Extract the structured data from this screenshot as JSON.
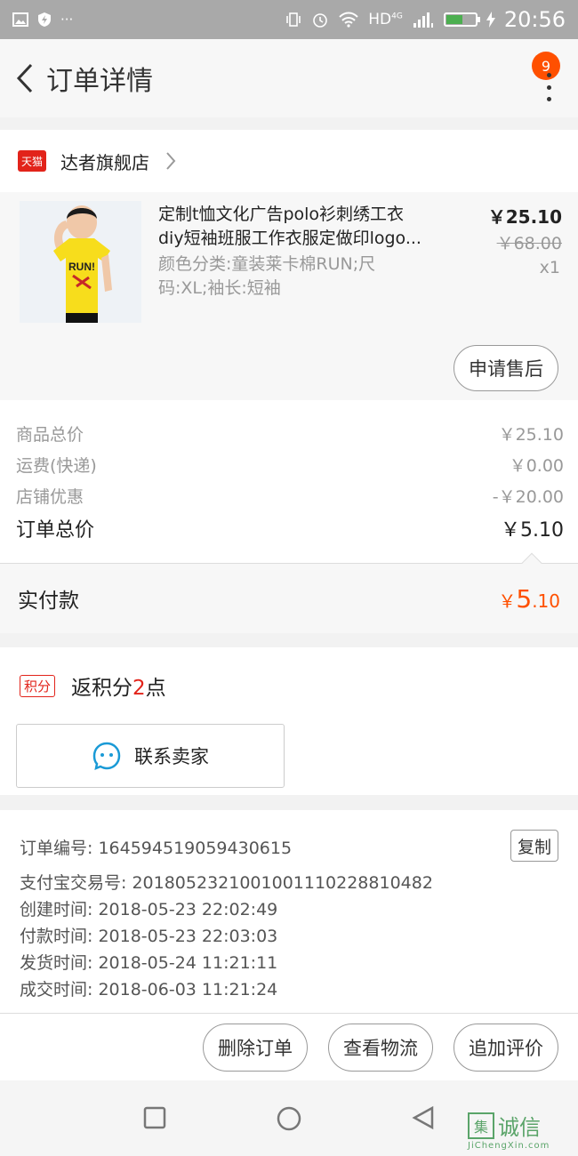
{
  "status_bar": {
    "time": "20:56",
    "network": "HD",
    "network_sub": "4G"
  },
  "header": {
    "title": "订单详情",
    "badge_count": "9"
  },
  "shop": {
    "platform_icon_label": "天猫",
    "name": "达者旗舰店"
  },
  "product": {
    "title_line1": "定制t恤文化广告polo衫刺绣工衣",
    "title_line2": "diy短袖班服工作衣服定做印logo...",
    "sku_line1": "颜色分类:童装莱卡棉RUN;尺",
    "sku_line2": "码:XL;袖长:短袖",
    "price": "￥25.10",
    "original_price": "￥68.00",
    "quantity": "x1",
    "image_text": "RUN!",
    "aftersale_label": "申请售后"
  },
  "summary": {
    "rows": [
      {
        "label": "商品总价",
        "value": "￥25.10"
      },
      {
        "label": "运费(快递)",
        "value": "￥0.00"
      },
      {
        "label": "店铺优惠",
        "value": "-￥20.00"
      }
    ],
    "total_label": "订单总价",
    "total_value": "￥5.10",
    "paid_label": "实付款",
    "paid_currency": "￥",
    "paid_int": "5",
    "paid_dec": ".10"
  },
  "points": {
    "tag": "积分",
    "prefix": "返积分",
    "count": "2",
    "suffix": "点"
  },
  "contact": {
    "label": "联系卖家"
  },
  "order": {
    "number_label": "订单编号:",
    "number": "164594519059430615",
    "copy_label": "复制",
    "lines": [
      {
        "label": "支付宝交易号:",
        "value": "2018052321001001110228810482"
      },
      {
        "label": "创建时间:",
        "value": "2018-05-23 22:02:49"
      },
      {
        "label": "付款时间:",
        "value": "2018-05-23 22:03:03"
      },
      {
        "label": "发货时间:",
        "value": "2018-05-24 11:21:11"
      },
      {
        "label": "成交时间:",
        "value": "2018-06-03 11:21:24"
      }
    ]
  },
  "actions": {
    "delete": "删除订单",
    "logistics": "查看物流",
    "review": "追加评价"
  },
  "watermark": {
    "text": "诚信",
    "box": "集",
    "url": "JiChengXin.com"
  },
  "colors": {
    "accent": "#ff5000",
    "tmall_red": "#e2231a",
    "aliwangwang_blue": "#1a9ad6"
  }
}
